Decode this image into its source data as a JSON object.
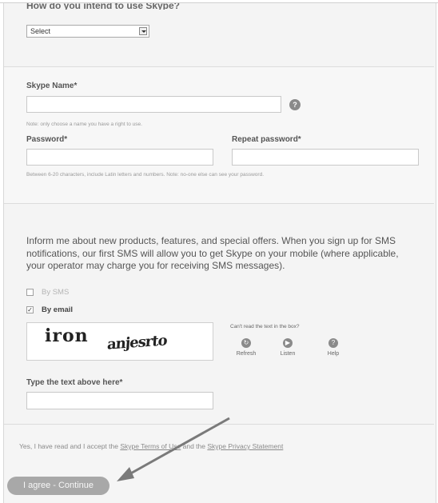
{
  "usage": {
    "heading_partial": "How do you intend to use Skype?",
    "select_value": "Select"
  },
  "account": {
    "skype_name_label": "Skype Name*",
    "skype_name_note": "Note: only choose a name you have a right to use.",
    "help_icon_glyph": "?",
    "password_label": "Password*",
    "repeat_password_label": "Repeat password*",
    "password_note": "Between 6-20 characters, include Latin letters and numbers. Note: no-one else can see your password."
  },
  "marketing": {
    "info_text": "Inform me about new products, features, and special offers. When you sign up for SMS notifications, our first SMS will allow you to get Skype on your mobile (where applicable, your operator may charge you for receiving SMS messages).",
    "by_sms_label": "By SMS",
    "by_sms_checked": false,
    "by_email_label": "By email",
    "by_email_checked": true
  },
  "captcha": {
    "word1": "iron",
    "word2": "anjesrto",
    "cant_read": "Can't read the text in the box?",
    "refresh_label": "Refresh",
    "listen_label": "Listen",
    "help_label": "Help",
    "type_text_label": "Type the text above here*"
  },
  "terms": {
    "accept_prefix": "Yes, I have read and I accept the",
    "terms_link": "Skype Terms of Use",
    "and": "and the",
    "privacy_link": "Skype Privacy Statement",
    "continue_label": "I agree - Continue"
  },
  "colors": {
    "background": "#f4f4f4",
    "button": "#a8a8a8",
    "icon": "#8a8a8a"
  }
}
